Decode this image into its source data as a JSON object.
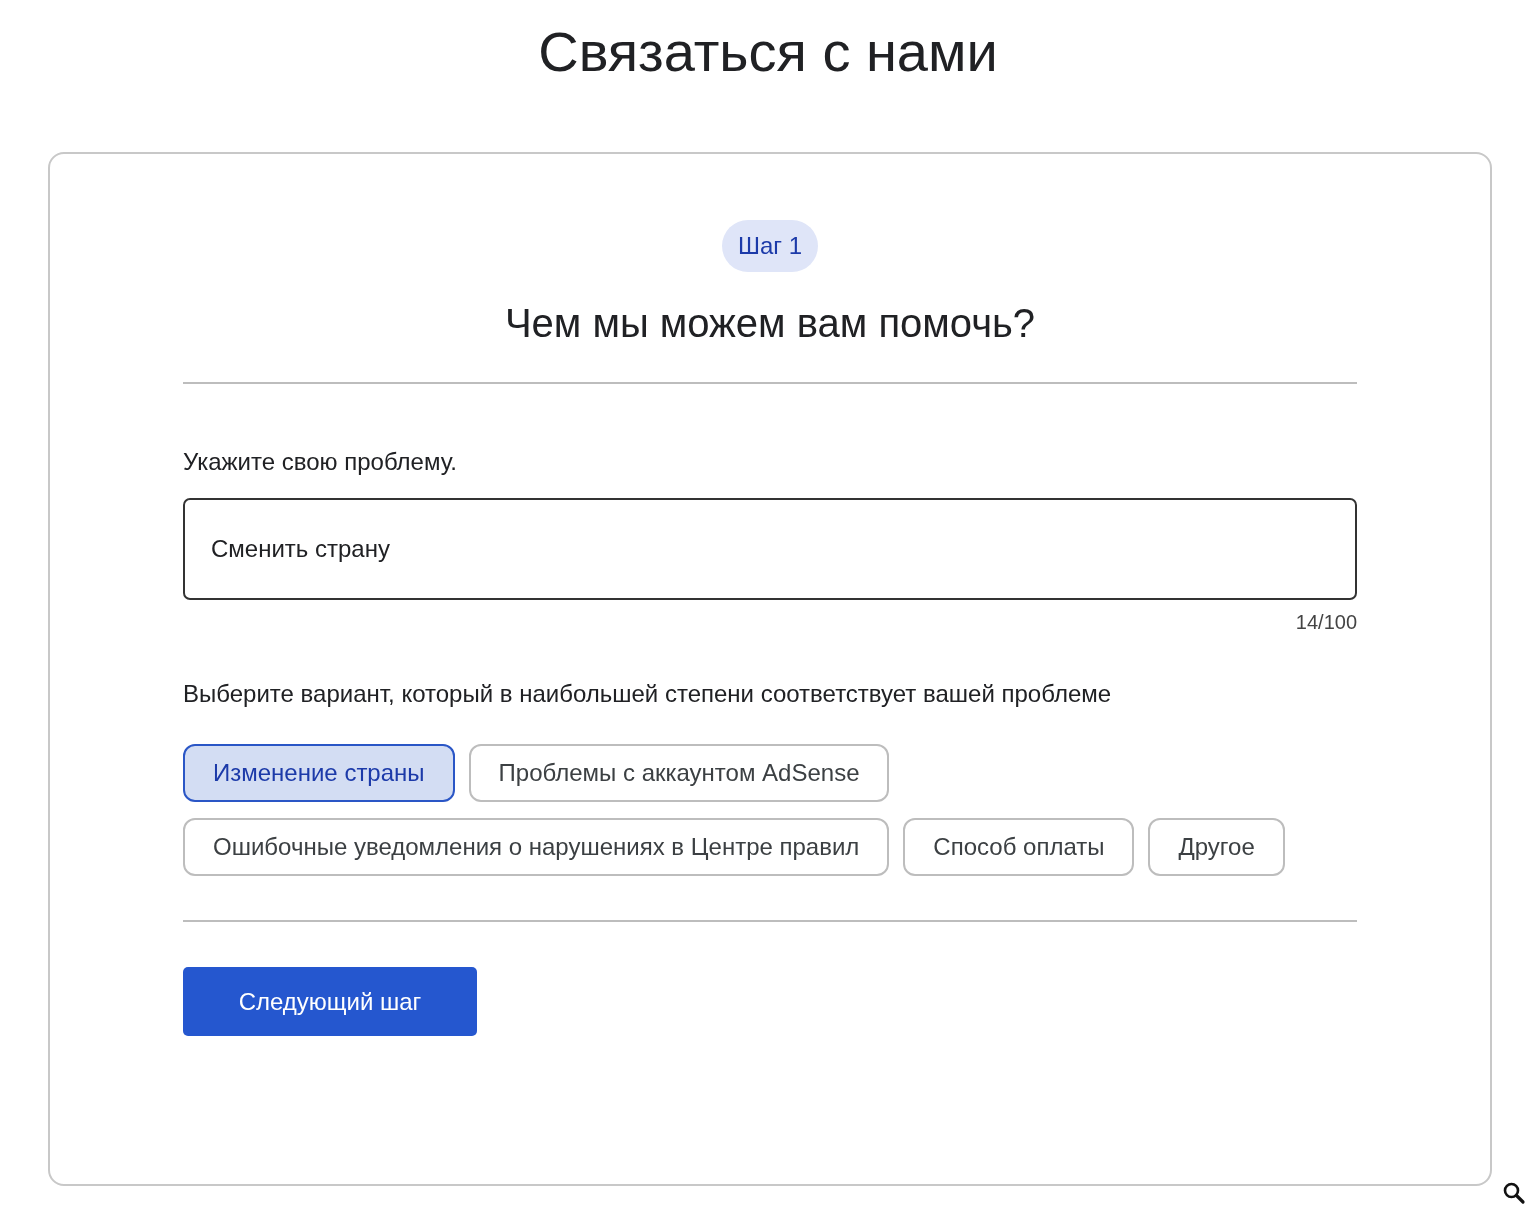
{
  "page_title": "Связаться с нами",
  "step": {
    "badge": "Шаг 1",
    "heading": "Чем мы можем вам помочь?"
  },
  "problem": {
    "label": "Укажите свою проблему.",
    "value": "Сменить страну",
    "counter": "14/100"
  },
  "options_prompt": "Выберите вариант, который в наибольшей степени соответствует вашей проблеме",
  "options": [
    {
      "label": "Изменение страны",
      "selected": true
    },
    {
      "label": "Проблемы с аккаунтом AdSense",
      "selected": false
    },
    {
      "label": "Ошибочные уведомления о нарушениях в Центре правил",
      "selected": false
    },
    {
      "label": "Способ оплаты",
      "selected": false
    },
    {
      "label": "Другое",
      "selected": false
    }
  ],
  "next_button": "Следующий шаг"
}
